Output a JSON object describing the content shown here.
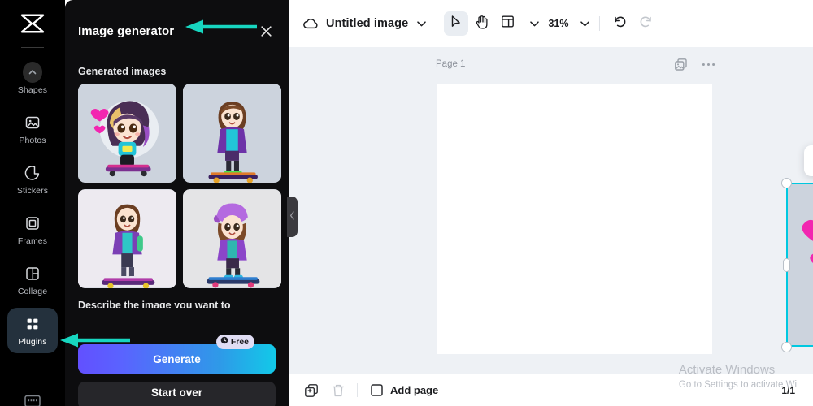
{
  "app": {
    "logo_icon": "capcut-logo"
  },
  "sidebar": {
    "items": [
      {
        "label": "Shapes",
        "icon": "chevron-up-circle-icon",
        "active": false
      },
      {
        "label": "Photos",
        "icon": "photo-icon",
        "active": false
      },
      {
        "label": "Stickers",
        "icon": "sticker-icon",
        "active": false
      },
      {
        "label": "Frames",
        "icon": "frame-icon",
        "active": false
      },
      {
        "label": "Collage",
        "icon": "collage-icon",
        "active": false
      },
      {
        "label": "Plugins",
        "icon": "plugins-grid-icon",
        "active": true
      }
    ],
    "bottom_icon": "keyboard-icon"
  },
  "panel": {
    "title": "Image generator",
    "close_icon": "close-icon",
    "section_title": "Generated images",
    "thumbnails": [
      {
        "alt": "girl on purple skateboard with hearts sticker"
      },
      {
        "alt": "girl standing on skateboard purple jacket sticker"
      },
      {
        "alt": "girl riding skateboard with backpack sticker"
      },
      {
        "alt": "girl with purple beanie on blue skateboard sticker"
      }
    ],
    "prompt_label": "Describe the image you want to",
    "generate_label": "Generate",
    "free_badge": "Free",
    "free_badge_icon": "clock-icon",
    "start_over_label": "Start over",
    "collapse_icon": "chevron-left-icon"
  },
  "topbar": {
    "cloud_icon": "cloud-save-icon",
    "doc_title": "Untitled image",
    "doc_chevron_icon": "chevron-down-icon",
    "tools": [
      {
        "name": "select-tool",
        "icon": "cursor-arrow-icon",
        "selected": true
      },
      {
        "name": "hand-tool",
        "icon": "hand-icon",
        "selected": false
      },
      {
        "name": "layout-tool",
        "icon": "layout-panel-icon",
        "selected": false
      }
    ],
    "layout_chevron_icon": "chevron-down-icon",
    "zoom_level": "31%",
    "zoom_chevron_icon": "chevron-down-icon",
    "undo_icon": "undo-icon",
    "redo_icon": "redo-icon"
  },
  "canvas": {
    "page_label": "Page 1",
    "duplicate_page_icon": "duplicate-page-icon",
    "more_icon": "more-horizontal-icon",
    "selection": {
      "float_toolbar": [
        {
          "name": "crop-button",
          "icon": "crop-icon"
        },
        {
          "name": "replace-button",
          "icon": "swap-replace-icon"
        },
        {
          "name": "duplicate-button",
          "icon": "duplicate-icon"
        },
        {
          "name": "more-button",
          "icon": "more-horizontal-icon"
        }
      ],
      "rotate_icon": "rotate-icon",
      "accent_color": "#00c8e0"
    }
  },
  "bottombar": {
    "duplicate_icon": "duplicate-page-icon",
    "delete_icon": "trash-icon",
    "add_page_icon": "add-page-square-icon",
    "add_page_label": "Add page",
    "page_count": "1/1"
  },
  "watermark": {
    "line1": "Activate Windows",
    "line2": "Go to Settings to activate Wi"
  },
  "annotations": {
    "arrow_color": "#17d6c0",
    "arrows": [
      {
        "name": "arrow-to-panel-title"
      },
      {
        "name": "arrow-to-plugins"
      }
    ]
  }
}
